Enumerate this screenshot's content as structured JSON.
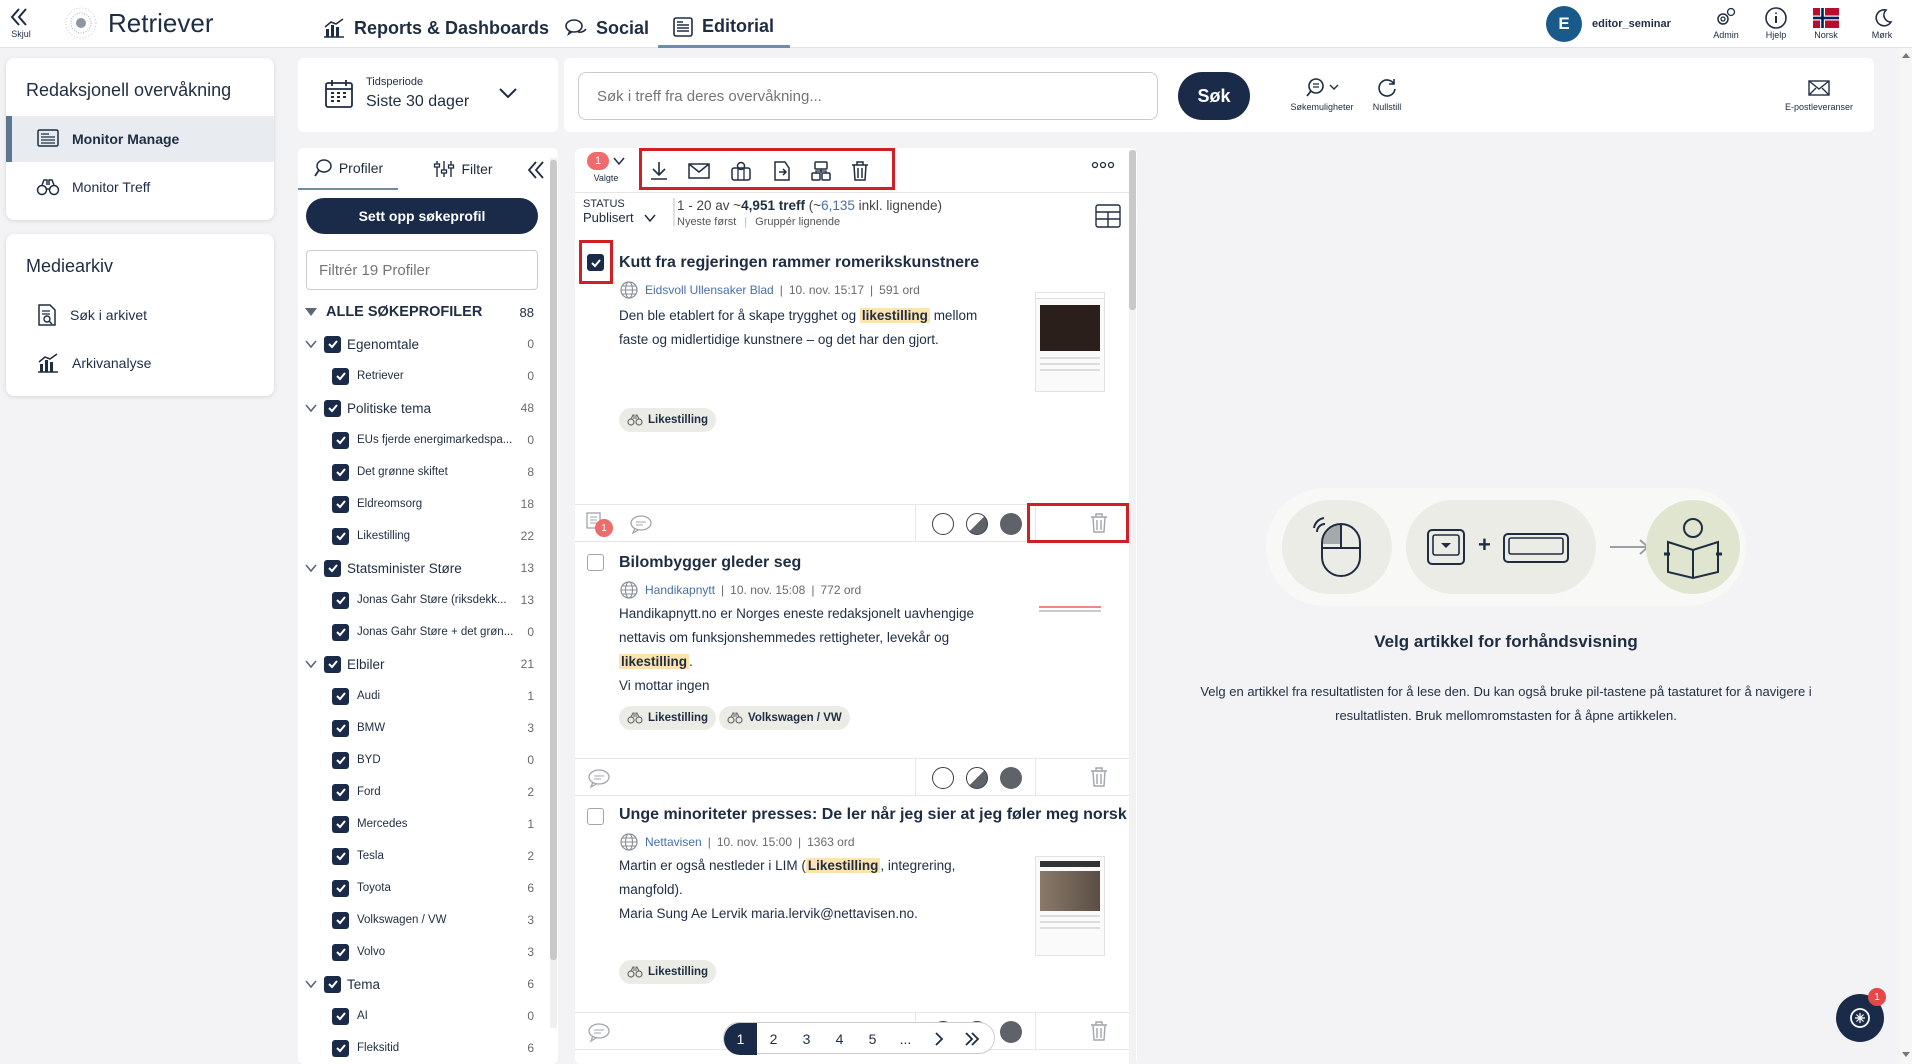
{
  "topbar": {
    "hide_label": "Skjul",
    "brand": "Retriever",
    "nav": [
      {
        "label": "Reports & Dashboards"
      },
      {
        "label": "Social"
      },
      {
        "label": "Editorial"
      }
    ],
    "user_initial": "E",
    "username": "editor_seminar",
    "right_items": [
      {
        "label": "Admin"
      },
      {
        "label": "Hjelp"
      },
      {
        "label": "Norsk"
      },
      {
        "label": "Mørk"
      }
    ]
  },
  "leftnav": {
    "section1_title": "Redaksjonell overvåkning",
    "section1_items": [
      {
        "label": "Monitor Manage"
      },
      {
        "label": "Monitor Treff"
      }
    ],
    "section2_title": "Mediearkiv",
    "section2_items": [
      {
        "label": "Søk i arkivet"
      },
      {
        "label": "Arkivanalyse"
      }
    ]
  },
  "period": {
    "label": "Tidsperiode",
    "value": "Siste 30 dager"
  },
  "search": {
    "placeholder": "Søk i treff fra deres overvåkning...",
    "button": "Søk",
    "options_label": "Søkemuligheter",
    "reset_label": "Nullstill",
    "email_label": "E-postleveranser"
  },
  "profiles": {
    "tab_profiles": "Profiler",
    "tab_filter": "Filter",
    "setup_button": "Sett opp søkeprofil",
    "filter_placeholder": "Filtrér 19 Profiler",
    "all_label": "ALLE SØKEPROFILER",
    "all_count": "88",
    "tree": [
      {
        "label": "Egenomtale",
        "count": "0",
        "level": 0
      },
      {
        "label": "Retriever",
        "count": "0",
        "level": 1
      },
      {
        "label": "Politiske tema",
        "count": "48",
        "level": 0
      },
      {
        "label": "EUs fjerde energimarkedspa...",
        "count": "0",
        "level": 1
      },
      {
        "label": "Det grønne skiftet",
        "count": "8",
        "level": 1
      },
      {
        "label": "Eldreomsorg",
        "count": "18",
        "level": 1
      },
      {
        "label": "Likestilling",
        "count": "22",
        "level": 1
      },
      {
        "label": "Statsminister Støre",
        "count": "13",
        "level": 0
      },
      {
        "label": "Jonas Gahr Støre (riksdekk...",
        "count": "13",
        "level": 1
      },
      {
        "label": "Jonas Gahr Støre + det grøn...",
        "count": "0",
        "level": 1
      },
      {
        "label": "Elbiler",
        "count": "21",
        "level": 0
      },
      {
        "label": "Audi",
        "count": "1",
        "level": 1
      },
      {
        "label": "BMW",
        "count": "3",
        "level": 1
      },
      {
        "label": "BYD",
        "count": "0",
        "level": 1
      },
      {
        "label": "Ford",
        "count": "2",
        "level": 1
      },
      {
        "label": "Mercedes",
        "count": "1",
        "level": 1
      },
      {
        "label": "Tesla",
        "count": "2",
        "level": 1
      },
      {
        "label": "Toyota",
        "count": "6",
        "level": 1
      },
      {
        "label": "Volkswagen / VW",
        "count": "3",
        "level": 1
      },
      {
        "label": "Volvo",
        "count": "3",
        "level": 1
      },
      {
        "label": "Tema",
        "count": "6",
        "level": 0
      },
      {
        "label": "AI",
        "count": "0",
        "level": 1
      },
      {
        "label": "Fleksitid",
        "count": "6",
        "level": 1
      }
    ]
  },
  "results": {
    "selected_count": "1",
    "selected_label": "Valgte",
    "status_label": "STATUS",
    "status_value": "Publisert",
    "range_text": "1 - 20 av ~",
    "hits": "4,951 treff",
    "similar_text": " (~",
    "similar_count": "6,135",
    "similar_suffix": " inkl. lignende)",
    "sort_label": "Nyeste først",
    "group_label": "Gruppér lignende",
    "articles": [
      {
        "title": "Kutt fra regjeringen rammer romerikskunstnere",
        "source": "Eidsvoll Ullensaker Blad",
        "date": "10. nov. 15:17",
        "words": "591 ord",
        "text_before": "Den ble etablert for å skape trygghet og ",
        "highlight": "likestilling",
        "text_after": " mellom faste og midlertidige kunstnere – og det har den gjort.",
        "tags": [
          "Likestilling"
        ],
        "comment_count": "1"
      },
      {
        "title": "Bilombygger gleder seg",
        "source": "Handikapnytt",
        "date": "10. nov. 15:08",
        "words": "772 ord",
        "text_before": "Handikapnytt.no er Norges eneste redaksjonelt uavhengige nettavis om funksjonshemmedes rettigheter, levekår og ",
        "highlight": "likestilling",
        "text_after": ".",
        "text_line2": "Vi mottar ingen",
        "tags": [
          "Likestilling",
          "Volkswagen / VW"
        ]
      },
      {
        "title": "Unge minoriteter presses: De ler når jeg sier at jeg føler meg norsk",
        "source": "Nettavisen",
        "date": "10. nov. 15:00",
        "words": "1363 ord",
        "text_before": "Martin er også nestleder i LIM (",
        "highlight": "Likestilling",
        "text_after": ", integrering, mangfold).",
        "text_line2": "Maria Sung Ae Lervik maria.lervik@nettavisen.no.",
        "tags": [
          "Likestilling"
        ]
      }
    ],
    "pagination": [
      "1",
      "2",
      "3",
      "4",
      "5",
      "..."
    ]
  },
  "preview": {
    "title": "Velg artikkel for forhåndsvisning",
    "body": "Velg en artikkel fra resultatlisten for å lese den. Du kan også bruke pil-tastene på tastaturet for å navigere i resultatlisten. Bruk mellomromstasten for å åpne artikkelen.",
    "plus": "+"
  },
  "chat_badge": "1",
  "colors": {
    "navy": "#1a2b4a",
    "highlight": "#fde3b0",
    "red_annotation": "#d21f26",
    "badge": "#f06b6b"
  }
}
